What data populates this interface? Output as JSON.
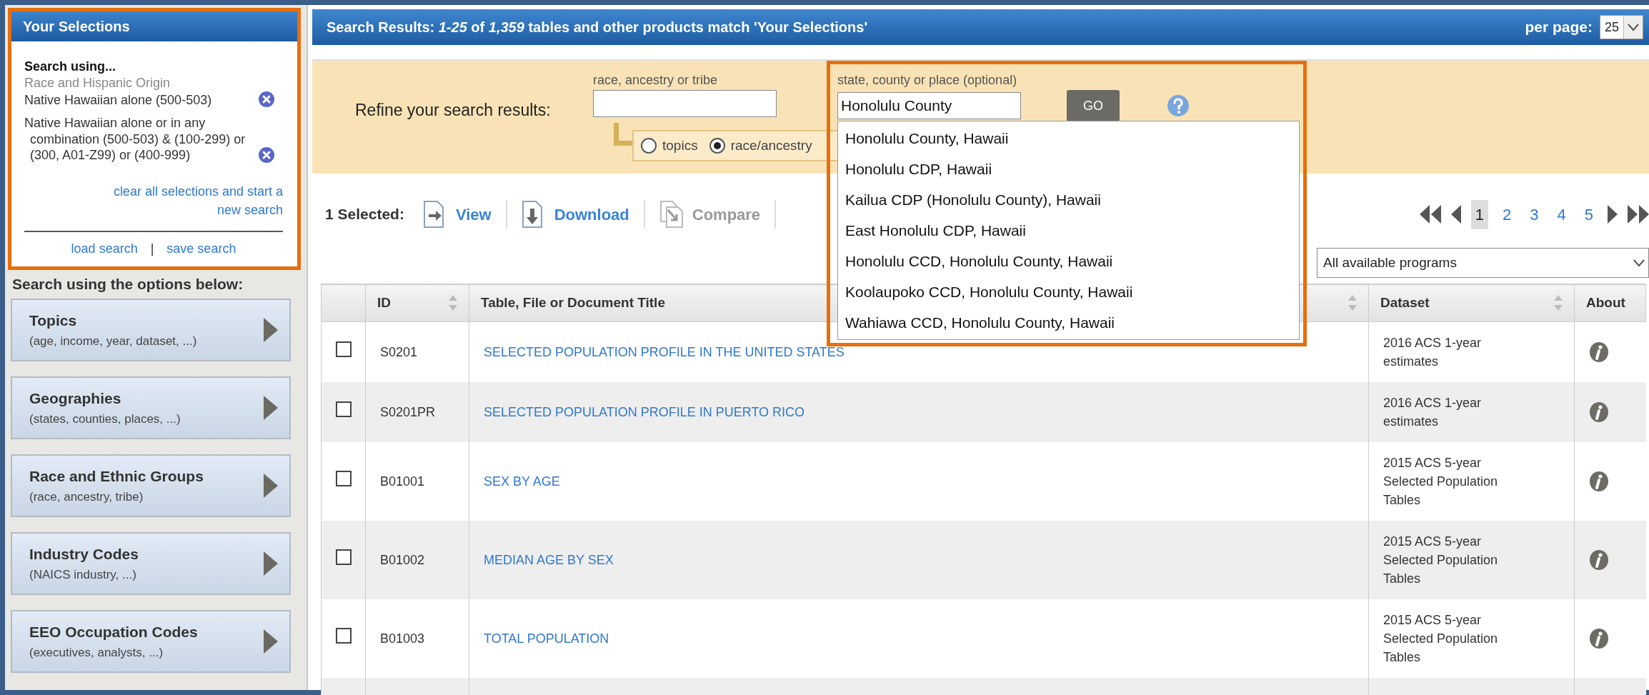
{
  "selections_panel": {
    "title": "Your Selections",
    "heading": "Search using...",
    "category": "Race and Hispanic Origin",
    "items": [
      {
        "label": "Native Hawaiian alone (500-503)"
      },
      {
        "label": "Native Hawaiian alone or in any combination (500-503) & (100-299) or (300, A01-Z99) or (400-999)"
      }
    ],
    "clear_link": "clear all selections and start a new search",
    "load_link": "load search",
    "separator": "|",
    "save_link": "save search"
  },
  "options_heading": "Search using the options below:",
  "option_buttons": [
    {
      "title": "Topics",
      "subtitle": "(age, income, year, dataset, ...)"
    },
    {
      "title": "Geographies",
      "subtitle": "(states, counties, places, ...)"
    },
    {
      "title": "Race and Ethnic Groups",
      "subtitle": "(race, ancestry, tribe)"
    },
    {
      "title": "Industry Codes",
      "subtitle": "(NAICS industry, ...)"
    },
    {
      "title": "EEO Occupation Codes",
      "subtitle": "(executives, analysts, ...)"
    }
  ],
  "results_header": {
    "text": "Search Results:  *1-25* of *1,359* tables and other products match 'Your Selections'",
    "per_page_label": "per page:",
    "per_page_value": "25"
  },
  "refine": {
    "label": "Refine your search results:",
    "race_field": {
      "label": "race, ancestry or tribe"
    },
    "geo_field": {
      "label": "state, county or place (optional)",
      "value": "Honolulu County"
    },
    "go_button": "GO",
    "radios": [
      {
        "label": "topics",
        "selected": false
      },
      {
        "label": "race/ancestry",
        "selected": true
      }
    ],
    "suggestions": [
      "Honolulu County, Hawaii",
      "Honolulu CDP, Hawaii",
      "Kailua CDP (Honolulu County), Hawaii",
      "East Honolulu CDP, Hawaii",
      "Honolulu CCD, Honolulu County, Hawaii",
      "Koolaupoko CCD, Honolulu County, Hawaii",
      "Wahiawa CCD, Honolulu County, Hawaii"
    ]
  },
  "toolbar": {
    "selected_label": "1 Selected:",
    "actions": [
      {
        "kind": "view",
        "label": "View",
        "disabled": false
      },
      {
        "kind": "download",
        "label": "Download",
        "disabled": false
      },
      {
        "kind": "compare",
        "label": "Compare",
        "disabled": true
      }
    ]
  },
  "pagination": {
    "pages": [
      {
        "label": "1",
        "selected": true
      },
      {
        "label": "2",
        "selected": false
      },
      {
        "label": "3",
        "selected": false
      },
      {
        "label": "4",
        "selected": false
      },
      {
        "label": "5",
        "selected": false
      }
    ]
  },
  "program_filter": {
    "value": "All available programs"
  },
  "table": {
    "columns": [
      {
        "label": "ID",
        "sortable": true
      },
      {
        "label": "Table, File or Document Title",
        "sortable": true
      },
      {
        "label": "Dataset",
        "sortable": true
      },
      {
        "label": "About",
        "sortable": false
      }
    ],
    "rows": [
      {
        "checked": false,
        "id": "S0201",
        "title": "SELECTED POPULATION PROFILE IN THE UNITED STATES",
        "dataset": "2016 ACS 1-year estimates"
      },
      {
        "checked": false,
        "id": "S0201PR",
        "title": "SELECTED POPULATION PROFILE IN PUERTO RICO",
        "dataset": "2016 ACS 1-year estimates"
      },
      {
        "checked": false,
        "id": "B01001",
        "title": "SEX BY AGE",
        "dataset": "2015 ACS 5-year Selected Population Tables"
      },
      {
        "checked": false,
        "id": "B01002",
        "title": "MEDIAN AGE BY SEX",
        "dataset": "2015 ACS 5-year Selected Population Tables"
      },
      {
        "checked": false,
        "id": "B01003",
        "title": "TOTAL POPULATION",
        "dataset": "2015 ACS 5-year Selected Population Tables"
      }
    ]
  }
}
